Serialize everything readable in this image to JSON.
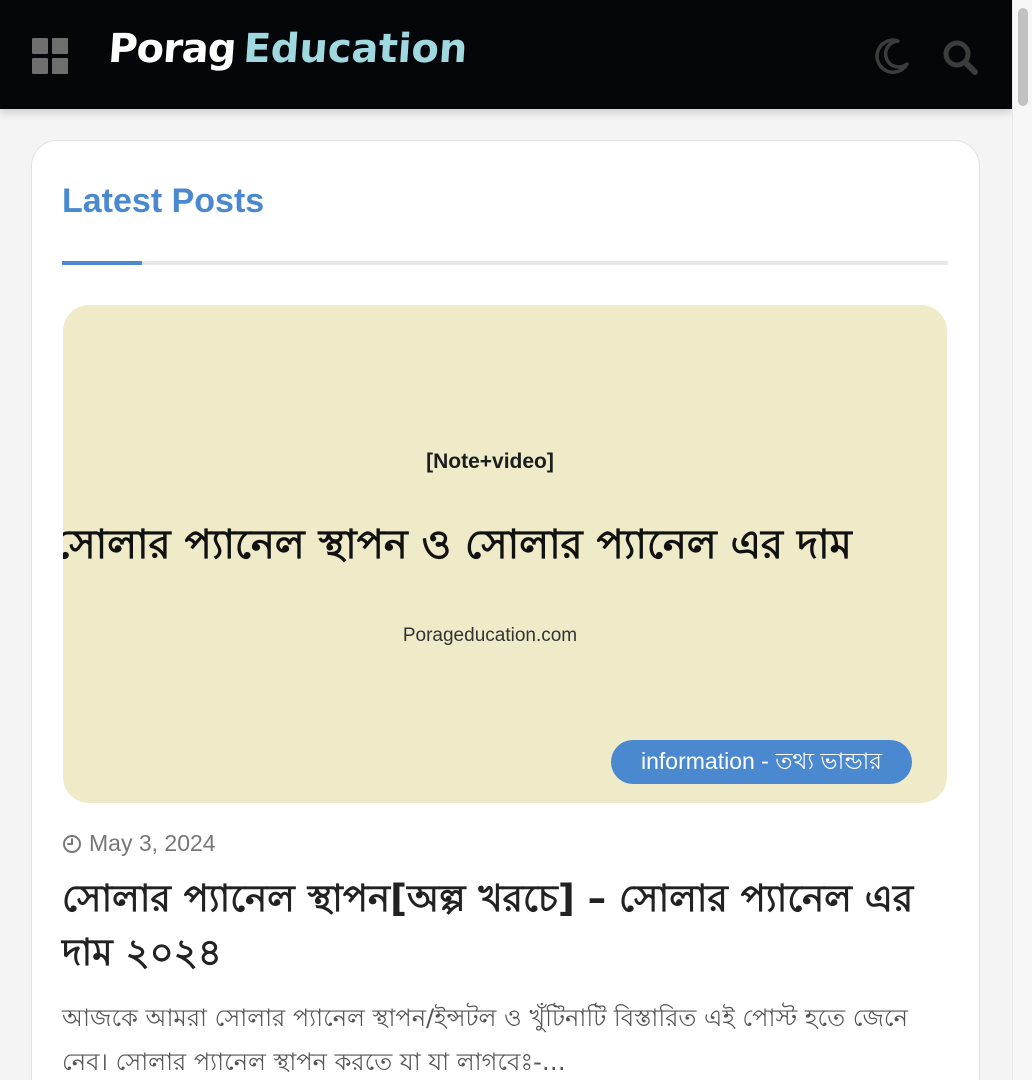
{
  "header": {
    "logo_word1": "Porag",
    "logo_word2": "Education",
    "icons": [
      "grid-menu-icon",
      "moon-icon",
      "search-icon"
    ]
  },
  "section": {
    "title": "Latest Posts"
  },
  "post": {
    "image": {
      "note": "[Note+video]",
      "headline": "সোলার প্যানেল স্থাপন ও সোলার প্যানেল এর দাম",
      "site": "Porageducation.com"
    },
    "category": "information - তথ্য ভান্ডার",
    "date": "May 3, 2024",
    "title": "সোলার প্যানেল স্থাপন[অল্প খরচে] – সোলার প্যানেল এর দাম ২০২৪",
    "excerpt": "আজকে আমরা সোলার প্যানেল স্থাপন/ইন্সটল ও খুঁটিনাটি বিস্তারিত এই পোস্ট হতে জেনে নেব। সোলার প্যানেল স্থাপন করতে যা যা লাগবেঃ-…"
  },
  "colors": {
    "header_bg": "#05060a",
    "accent": "#4a89d0",
    "logo_secondary": "#9fd8df",
    "image_bg": "#efeac8"
  }
}
